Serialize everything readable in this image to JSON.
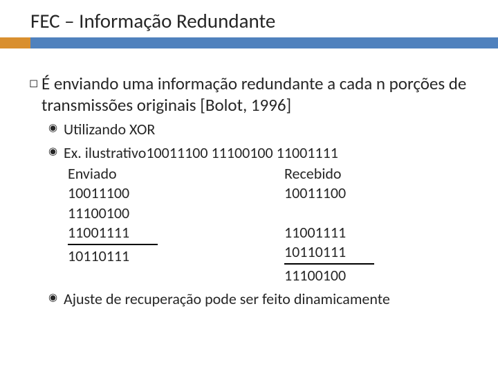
{
  "title": "FEC – Informação Redundante",
  "bullets": {
    "l1_text": "É enviando uma informação redundante a cada n porções de transmissões originais [Bolot, 1996]",
    "l2a": "Utilizando XOR",
    "l2b": "Ex. ilustrativo10011100 11100100 11001111",
    "l2c": "Ajuste de recuperação pode ser feito dinamicamente"
  },
  "example": {
    "sent_header": "Enviado",
    "sent": [
      "10011100",
      "11100100",
      "11001111",
      "10110111"
    ],
    "recv_header": "Recebido",
    "recv_top": [
      "10011100"
    ],
    "recv_mid": [
      "11001111",
      "10110111"
    ],
    "recv_recovered": "11100100"
  },
  "glyphs": {
    "box": "◻",
    "target": "◉"
  }
}
